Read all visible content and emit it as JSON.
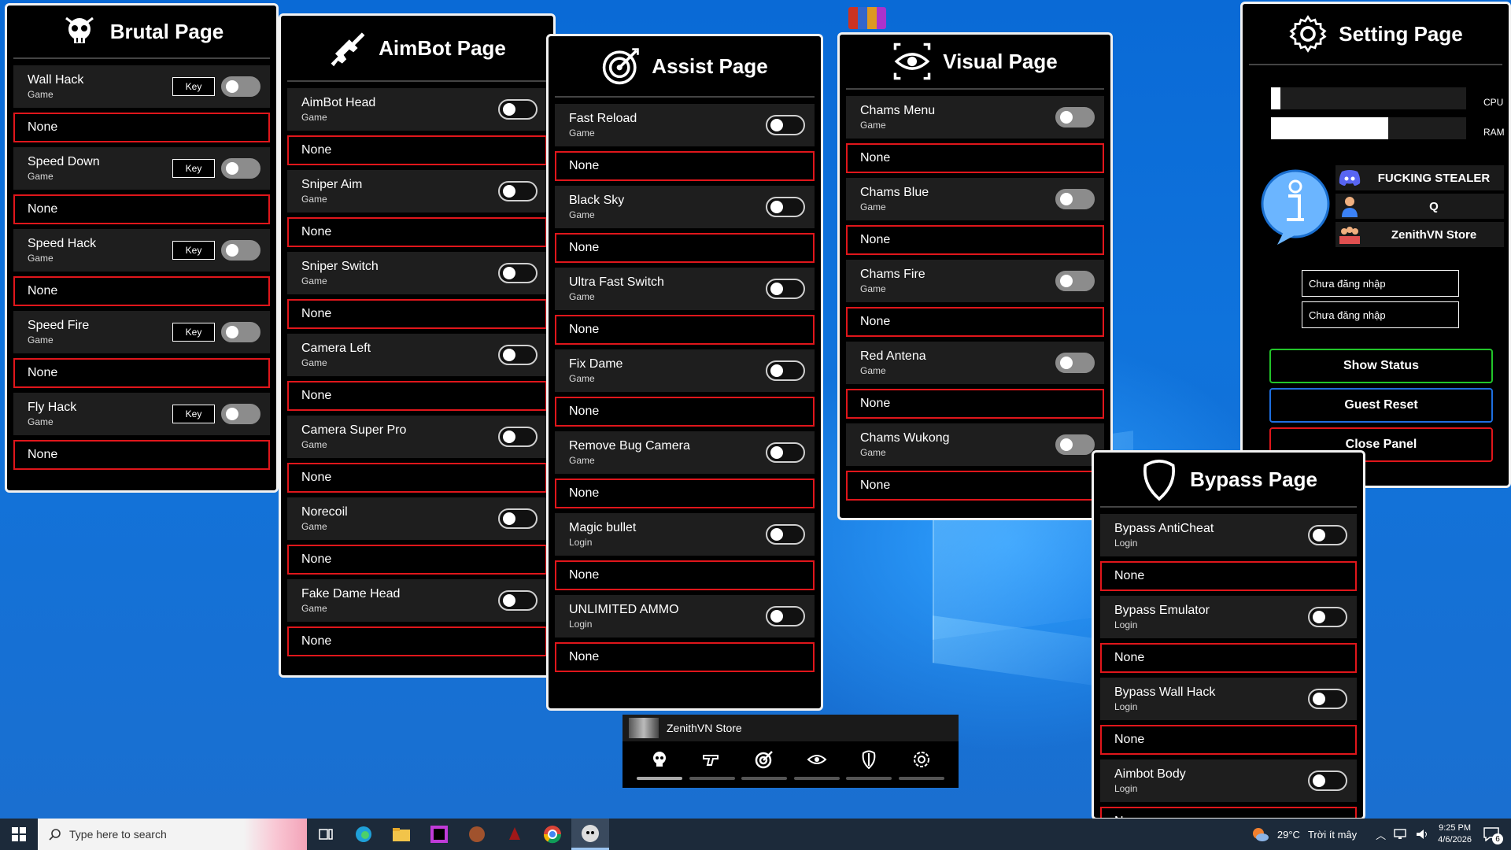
{
  "brutal": {
    "title": "Brutal Page",
    "rows": [
      {
        "title": "Wall Hack",
        "sub": "Game",
        "key": "Key",
        "bind": "None"
      },
      {
        "title": "Speed Down",
        "sub": "Game",
        "key": "Key",
        "bind": "None"
      },
      {
        "title": "Speed Hack",
        "sub": "Game",
        "key": "Key",
        "bind": "None"
      },
      {
        "title": "Speed Fire",
        "sub": "Game",
        "key": "Key",
        "bind": "None"
      },
      {
        "title": "Fly Hack",
        "sub": "Game",
        "key": "Key",
        "bind": "None"
      }
    ]
  },
  "aimbot": {
    "title": "AimBot Page",
    "rows": [
      {
        "title": "AimBot Head",
        "sub": "Game",
        "bind": "None"
      },
      {
        "title": "Sniper Aim",
        "sub": "Game",
        "bind": "None"
      },
      {
        "title": "Sniper Switch",
        "sub": "Game",
        "bind": "None"
      },
      {
        "title": "Camera Left",
        "sub": "Game",
        "bind": "None"
      },
      {
        "title": "Camera Super Pro",
        "sub": "Game",
        "bind": "None"
      },
      {
        "title": "Norecoil",
        "sub": "Game",
        "bind": "None"
      },
      {
        "title": "Fake Dame Head",
        "sub": "Game",
        "bind": "None"
      }
    ]
  },
  "assist": {
    "title": "Assist Page",
    "rows": [
      {
        "title": "Fast Reload",
        "sub": "Game",
        "bind": "None"
      },
      {
        "title": "Black Sky",
        "sub": "Game",
        "bind": "None"
      },
      {
        "title": "Ultra Fast Switch",
        "sub": "Game",
        "bind": "None"
      },
      {
        "title": "Fix Dame",
        "sub": "Game",
        "bind": "None"
      },
      {
        "title": "Remove Bug Camera",
        "sub": "Game",
        "bind": "None"
      },
      {
        "title": "Magic bullet",
        "sub": "Login",
        "bind": "None"
      },
      {
        "title": "UNLIMITED AMMO",
        "sub": "Login",
        "bind": "None"
      }
    ]
  },
  "visual": {
    "title": "Visual Page",
    "rows": [
      {
        "title": "Chams Menu",
        "sub": "Game",
        "bind": "None"
      },
      {
        "title": "Chams Blue",
        "sub": "Game",
        "bind": "None"
      },
      {
        "title": "Chams Fire",
        "sub": "Game",
        "bind": "None"
      },
      {
        "title": "Red Antena",
        "sub": "Game",
        "bind": "None"
      },
      {
        "title": "Chams Wukong",
        "sub": "Game",
        "bind": "None"
      }
    ]
  },
  "setting": {
    "title": "Setting Page",
    "cpu_label": "CPU",
    "cpu_level": 0.05,
    "ram_label": "RAM",
    "ram_level": 0.6,
    "info": [
      "FUCKING STEALER",
      "Q",
      "ZenithVN Store"
    ],
    "login_fields": [
      "Chưa đăng nhập",
      "Chưa đăng nhập"
    ],
    "buttons": {
      "show_status": "Show Status",
      "guest_reset": "Guest Reset",
      "close_panel": "Close Panel"
    },
    "colors": {
      "show_status": "#22c52a",
      "guest_reset": "#1e6fe0",
      "close_panel": "#e0161b"
    }
  },
  "bypass": {
    "title": "Bypass Page",
    "rows": [
      {
        "title": "Bypass AntiCheat",
        "sub": "Login",
        "bind": "None"
      },
      {
        "title": "Bypass Emulator",
        "sub": "Login",
        "bind": "None"
      },
      {
        "title": "Bypass Wall Hack",
        "sub": "Login",
        "bind": "None"
      },
      {
        "title": "Aimbot Body",
        "sub": "Login",
        "bind": "None"
      }
    ]
  },
  "navbar": {
    "title": "ZenithVN Store",
    "items": [
      "skull-icon",
      "hand-gun-icon",
      "target-icon",
      "eye-icon",
      "shield-icon",
      "gear-icon"
    ]
  },
  "taskbar": {
    "search_placeholder": "Type here to search",
    "weather": "29°C",
    "weather_text": "Trời ít mây",
    "time": "9:25 PM",
    "date": "4/6/2026",
    "notifications": "6"
  }
}
